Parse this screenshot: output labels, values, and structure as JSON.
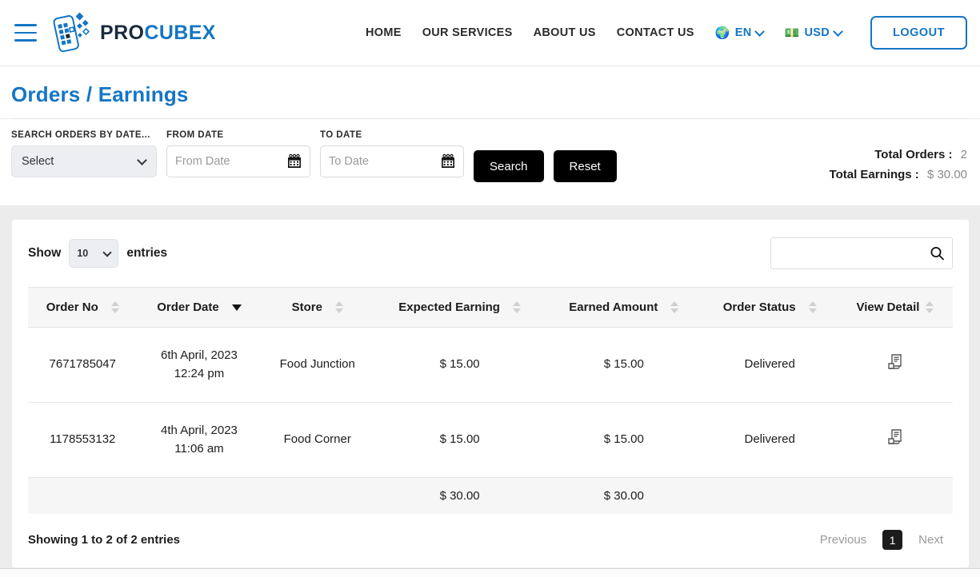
{
  "header": {
    "menu_icon": "hamburger-icon",
    "brand": {
      "part1": "PRO",
      "part2": "CUBEX"
    },
    "nav": [
      {
        "label": "HOME"
      },
      {
        "label": "OUR SERVICES"
      },
      {
        "label": "ABOUT US"
      },
      {
        "label": "CONTACT US"
      }
    ],
    "language": {
      "icon": "globe-icon",
      "glyph": "🌍",
      "label": "EN"
    },
    "currency": {
      "icon": "money-icon",
      "glyph": "💵",
      "label": "USD"
    },
    "logout_label": "LOGOUT",
    "accent_color": "#1576c4"
  },
  "page": {
    "title": "Orders / Earnings"
  },
  "filters": {
    "search_by_date_label": "SEARCH ORDERS BY DATE...",
    "select_value": "Select",
    "from_date_label": "FROM DATE",
    "from_date_placeholder": "From Date",
    "from_date_value": "",
    "to_date_label": "TO DATE",
    "to_date_placeholder": "To Date",
    "to_date_value": "",
    "search_button": "Search",
    "reset_button": "Reset",
    "calendar_icon": "calendar-icon"
  },
  "summary": {
    "total_orders_label": "Total Orders :",
    "total_orders_value": "2",
    "total_earnings_label": "Total Earnings :",
    "total_earnings_value": "$ 30.00"
  },
  "table_controls": {
    "show_label": "Show",
    "entries_label": "entries",
    "page_length": "10",
    "search_placeholder": "",
    "search_value": "",
    "search_icon": "search-icon"
  },
  "table": {
    "columns": [
      {
        "label": "Order No",
        "sort": "both"
      },
      {
        "label": "Order Date",
        "sort": "desc"
      },
      {
        "label": "Store",
        "sort": "both"
      },
      {
        "label": "Expected Earning",
        "sort": "both"
      },
      {
        "label": "Earned Amount",
        "sort": "both"
      },
      {
        "label": "Order Status",
        "sort": "both"
      },
      {
        "label": "View Detail",
        "sort": "both"
      }
    ],
    "rows": [
      {
        "order_no": "7671785047",
        "order_date": "6th April, 2023",
        "order_time": "12:24 pm",
        "store": "Food Junction",
        "expected_earning": "$ 15.00",
        "earned_amount": "$ 15.00",
        "order_status": "Delivered",
        "detail_icon": "receipt-icon"
      },
      {
        "order_no": "1178553132",
        "order_date": "4th April, 2023",
        "order_time": "11:06 am",
        "store": "Food Corner",
        "expected_earning": "$ 15.00",
        "earned_amount": "$ 15.00",
        "order_status": "Delivered",
        "detail_icon": "receipt-icon"
      }
    ],
    "footer": {
      "expected_total": "$ 30.00",
      "earned_total": "$ 30.00"
    }
  },
  "pagination": {
    "showing_text": "Showing 1 to 2 of 2 entries",
    "previous_label": "Previous",
    "current_page": "1",
    "next_label": "Next"
  }
}
